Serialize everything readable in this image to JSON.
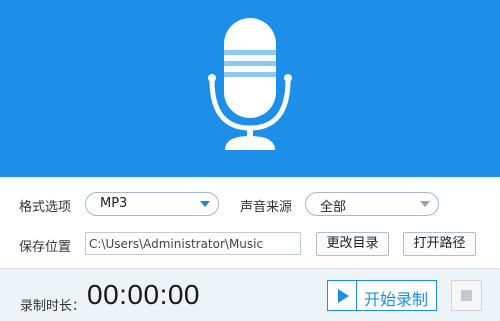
{
  "colors": {
    "accent": "#1e8fe8",
    "background": "#ffffff",
    "footer": "#eef3f8"
  },
  "hero": {
    "icon": "microphone-icon"
  },
  "format": {
    "label": "格式选项",
    "value": "MP3"
  },
  "source": {
    "label": "声音来源",
    "value": "全部"
  },
  "save": {
    "label": "保存位置",
    "path": "C:\\Users\\Administrator\\Music"
  },
  "buttons": {
    "change_dir": "更改目录",
    "open_path": "打开路径"
  },
  "footer": {
    "duration_label": "录制时长：",
    "duration_value": "00:00:00",
    "record_label": "开始录制",
    "record_icon": "play-icon",
    "stop_icon": "stop-icon"
  }
}
